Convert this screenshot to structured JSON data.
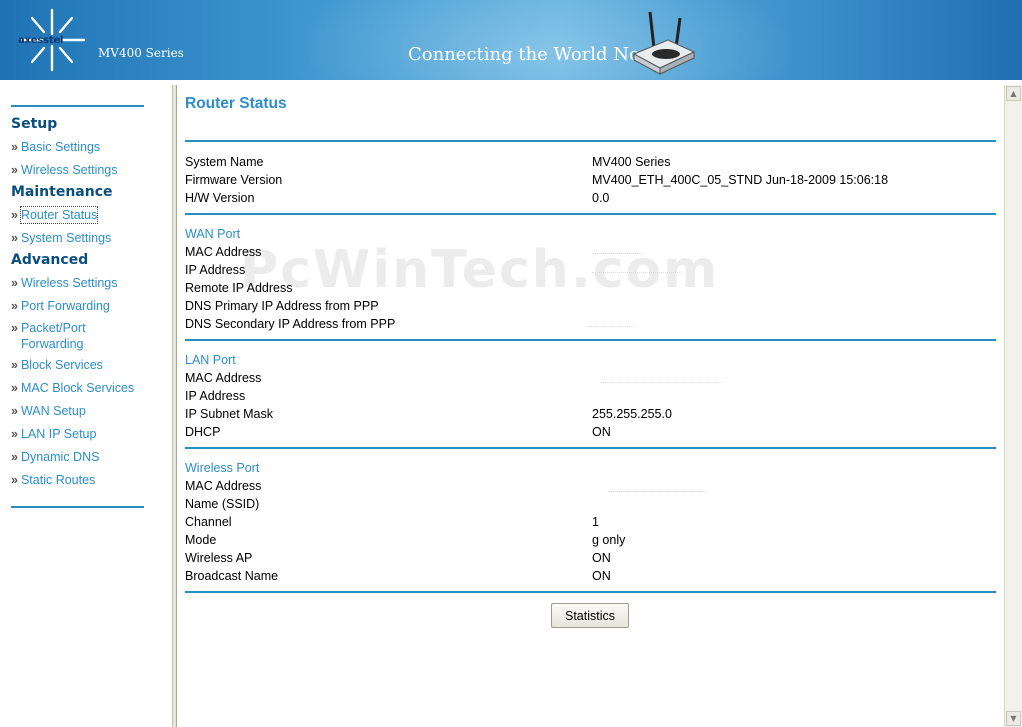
{
  "header": {
    "brand": "axesstel",
    "series": "MV400 Series",
    "tagline": "Connecting the World Now"
  },
  "sidebar": {
    "sections": [
      {
        "title": "Setup",
        "items": [
          {
            "label": "Basic Settings"
          },
          {
            "label": "Wireless Settings"
          }
        ]
      },
      {
        "title": "Maintenance",
        "items": [
          {
            "label": "Router Status",
            "active": true
          },
          {
            "label": "System Settings"
          }
        ]
      },
      {
        "title": "Advanced",
        "items": [
          {
            "label": "Wireless Settings"
          },
          {
            "label": "Port Forwarding"
          },
          {
            "label": "Packet/Port Forwarding"
          },
          {
            "label": "Block Services"
          },
          {
            "label": "MAC Block Services"
          },
          {
            "label": "WAN Setup"
          },
          {
            "label": "LAN IP Setup"
          },
          {
            "label": "Dynamic DNS"
          },
          {
            "label": "Static Routes"
          }
        ]
      }
    ]
  },
  "main": {
    "title": "Router Status",
    "system": {
      "system_name_label": "System Name",
      "system_name": "MV400 Series",
      "firmware_label": "Firmware Version",
      "firmware": "MV400_ETH_400C_05_STND Jun-18-2009 15:06:18",
      "hw_label": "H/W Version",
      "hw": "0.0"
    },
    "wan": {
      "title": "WAN Port",
      "mac_label": "MAC Address",
      "mac": "",
      "ip_label": "IP Address",
      "ip": "",
      "remote_ip_label": "Remote IP Address",
      "remote_ip": "",
      "dns_primary_label": "DNS Primary IP Address from PPP",
      "dns_primary": "",
      "dns_secondary_label": "DNS Secondary IP Address from PPP",
      "dns_secondary": ""
    },
    "lan": {
      "title": "LAN Port",
      "mac_label": "MAC Address",
      "mac": "",
      "ip_label": "IP Address",
      "ip": "",
      "subnet_label": "IP Subnet Mask",
      "subnet": "255.255.255.0",
      "dhcp_label": "DHCP",
      "dhcp": "ON"
    },
    "wireless": {
      "title": "Wireless Port",
      "mac_label": "MAC Address",
      "mac": "",
      "ssid_label": "Name (SSID)",
      "ssid": "",
      "channel_label": "Channel",
      "channel": "1",
      "mode_label": "Mode",
      "mode": "g only",
      "ap_label": "Wireless AP",
      "ap": "ON",
      "broadcast_label": "Broadcast Name",
      "broadcast": "ON"
    },
    "statistics_button": "Statistics",
    "watermark": "PcWinTech.com"
  },
  "colors": {
    "accent": "#2d8ec9",
    "nav_head": "#0a4e80",
    "rule": "#2c8dc0"
  }
}
